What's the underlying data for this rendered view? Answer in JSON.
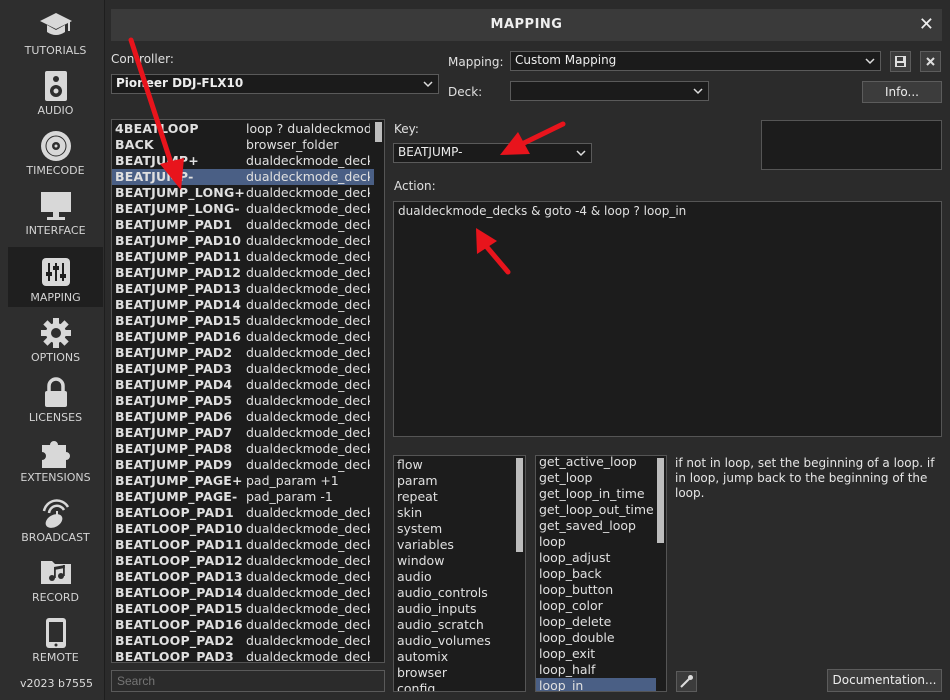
{
  "sidebar": {
    "items": [
      {
        "label": "TUTORIALS",
        "icon": "graduation-cap-icon"
      },
      {
        "label": "AUDIO",
        "icon": "speaker-icon"
      },
      {
        "label": "TIMECODE",
        "icon": "vinyl-icon"
      },
      {
        "label": "INTERFACE",
        "icon": "monitor-icon"
      },
      {
        "label": "MAPPING",
        "icon": "sliders-icon",
        "active": true
      },
      {
        "label": "OPTIONS",
        "icon": "gear-icon"
      },
      {
        "label": "LICENSES",
        "icon": "lock-icon"
      },
      {
        "label": "EXTENSIONS",
        "icon": "puzzle-icon"
      },
      {
        "label": "BROADCAST",
        "icon": "broadcast-icon"
      },
      {
        "label": "RECORD",
        "icon": "music-folder-icon"
      },
      {
        "label": "REMOTE",
        "icon": "phone-icon"
      }
    ],
    "version": "v2023 b7555"
  },
  "window": {
    "title": "MAPPING",
    "close": "✕"
  },
  "controller": {
    "label": "Controller:",
    "value": "Pioneer DDJ-FLX10"
  },
  "mapping": {
    "label": "Mapping:",
    "value": "Custom Mapping"
  },
  "deck": {
    "label": "Deck:",
    "value": ""
  },
  "info_button": "Info...",
  "key": {
    "label": "Key:",
    "value": "BEATJUMP-"
  },
  "action": {
    "label": "Action:",
    "value": "dualdeckmode_decks & goto -4 & loop ? loop_in"
  },
  "key_list": [
    {
      "key": "4BEATLOOP",
      "action": "loop ? dualdeckmode"
    },
    {
      "key": "BACK",
      "action": "browser_folder"
    },
    {
      "key": "BEATJUMP+",
      "action": "dualdeckmode_decks"
    },
    {
      "key": "BEATJUMP-",
      "action": "dualdeckmode_decks",
      "selected": true
    },
    {
      "key": "BEATJUMP_LONG+",
      "action": "dualdeckmode_decks"
    },
    {
      "key": "BEATJUMP_LONG-",
      "action": "dualdeckmode_decks"
    },
    {
      "key": "BEATJUMP_PAD1",
      "action": "dualdeckmode_decks"
    },
    {
      "key": "BEATJUMP_PAD10",
      "action": "dualdeckmode_decks"
    },
    {
      "key": "BEATJUMP_PAD11",
      "action": "dualdeckmode_decks"
    },
    {
      "key": "BEATJUMP_PAD12",
      "action": "dualdeckmode_decks"
    },
    {
      "key": "BEATJUMP_PAD13",
      "action": "dualdeckmode_decks"
    },
    {
      "key": "BEATJUMP_PAD14",
      "action": "dualdeckmode_decks"
    },
    {
      "key": "BEATJUMP_PAD15",
      "action": "dualdeckmode_decks"
    },
    {
      "key": "BEATJUMP_PAD16",
      "action": "dualdeckmode_decks"
    },
    {
      "key": "BEATJUMP_PAD2",
      "action": "dualdeckmode_decks"
    },
    {
      "key": "BEATJUMP_PAD3",
      "action": "dualdeckmode_decks"
    },
    {
      "key": "BEATJUMP_PAD4",
      "action": "dualdeckmode_decks"
    },
    {
      "key": "BEATJUMP_PAD5",
      "action": "dualdeckmode_decks"
    },
    {
      "key": "BEATJUMP_PAD6",
      "action": "dualdeckmode_decks"
    },
    {
      "key": "BEATJUMP_PAD7",
      "action": "dualdeckmode_decks"
    },
    {
      "key": "BEATJUMP_PAD8",
      "action": "dualdeckmode_decks"
    },
    {
      "key": "BEATJUMP_PAD9",
      "action": "dualdeckmode_decks"
    },
    {
      "key": "BEATJUMP_PAGE+",
      "action": "pad_param +1"
    },
    {
      "key": "BEATJUMP_PAGE-",
      "action": "pad_param -1"
    },
    {
      "key": "BEATLOOP_PAD1",
      "action": "dualdeckmode_decks"
    },
    {
      "key": "BEATLOOP_PAD10",
      "action": "dualdeckmode_decks"
    },
    {
      "key": "BEATLOOP_PAD11",
      "action": "dualdeckmode_decks"
    },
    {
      "key": "BEATLOOP_PAD12",
      "action": "dualdeckmode_decks"
    },
    {
      "key": "BEATLOOP_PAD13",
      "action": "dualdeckmode_decks"
    },
    {
      "key": "BEATLOOP_PAD14",
      "action": "dualdeckmode_decks"
    },
    {
      "key": "BEATLOOP_PAD15",
      "action": "dualdeckmode_decks"
    },
    {
      "key": "BEATLOOP_PAD16",
      "action": "dualdeckmode_decks"
    },
    {
      "key": "BEATLOOP_PAD2",
      "action": "dualdeckmode_decks"
    },
    {
      "key": "BEATLOOP_PAD3",
      "action": "dualdeckmode_decks"
    }
  ],
  "categories": [
    "flow",
    "param",
    "repeat",
    "skin",
    "system",
    "variables",
    "window",
    "audio",
    "audio_controls",
    "audio_inputs",
    "audio_scratch",
    "audio_volumes",
    "automix",
    "browser",
    "config"
  ],
  "verbs": [
    {
      "label": "get_active_loop"
    },
    {
      "label": "get_loop"
    },
    {
      "label": "get_loop_in_time"
    },
    {
      "label": "get_loop_out_time"
    },
    {
      "label": "get_saved_loop"
    },
    {
      "label": "loop"
    },
    {
      "label": "loop_adjust"
    },
    {
      "label": "loop_back"
    },
    {
      "label": "loop_button"
    },
    {
      "label": "loop_color"
    },
    {
      "label": "loop_delete"
    },
    {
      "label": "loop_double"
    },
    {
      "label": "loop_exit"
    },
    {
      "label": "loop_half"
    },
    {
      "label": "loop_in",
      "selected": true
    }
  ],
  "verb_help": "if not in loop, set the beginning of a loop. if in loop, jump back to the beginning of the loop.",
  "search_placeholder": "Search",
  "documentation_button": "Documentation...",
  "colors": {
    "background": "#2b2b2b",
    "panel": "#1c1c1c",
    "selection": "#4a5f85",
    "annotation_arrow": "#e8141c"
  }
}
